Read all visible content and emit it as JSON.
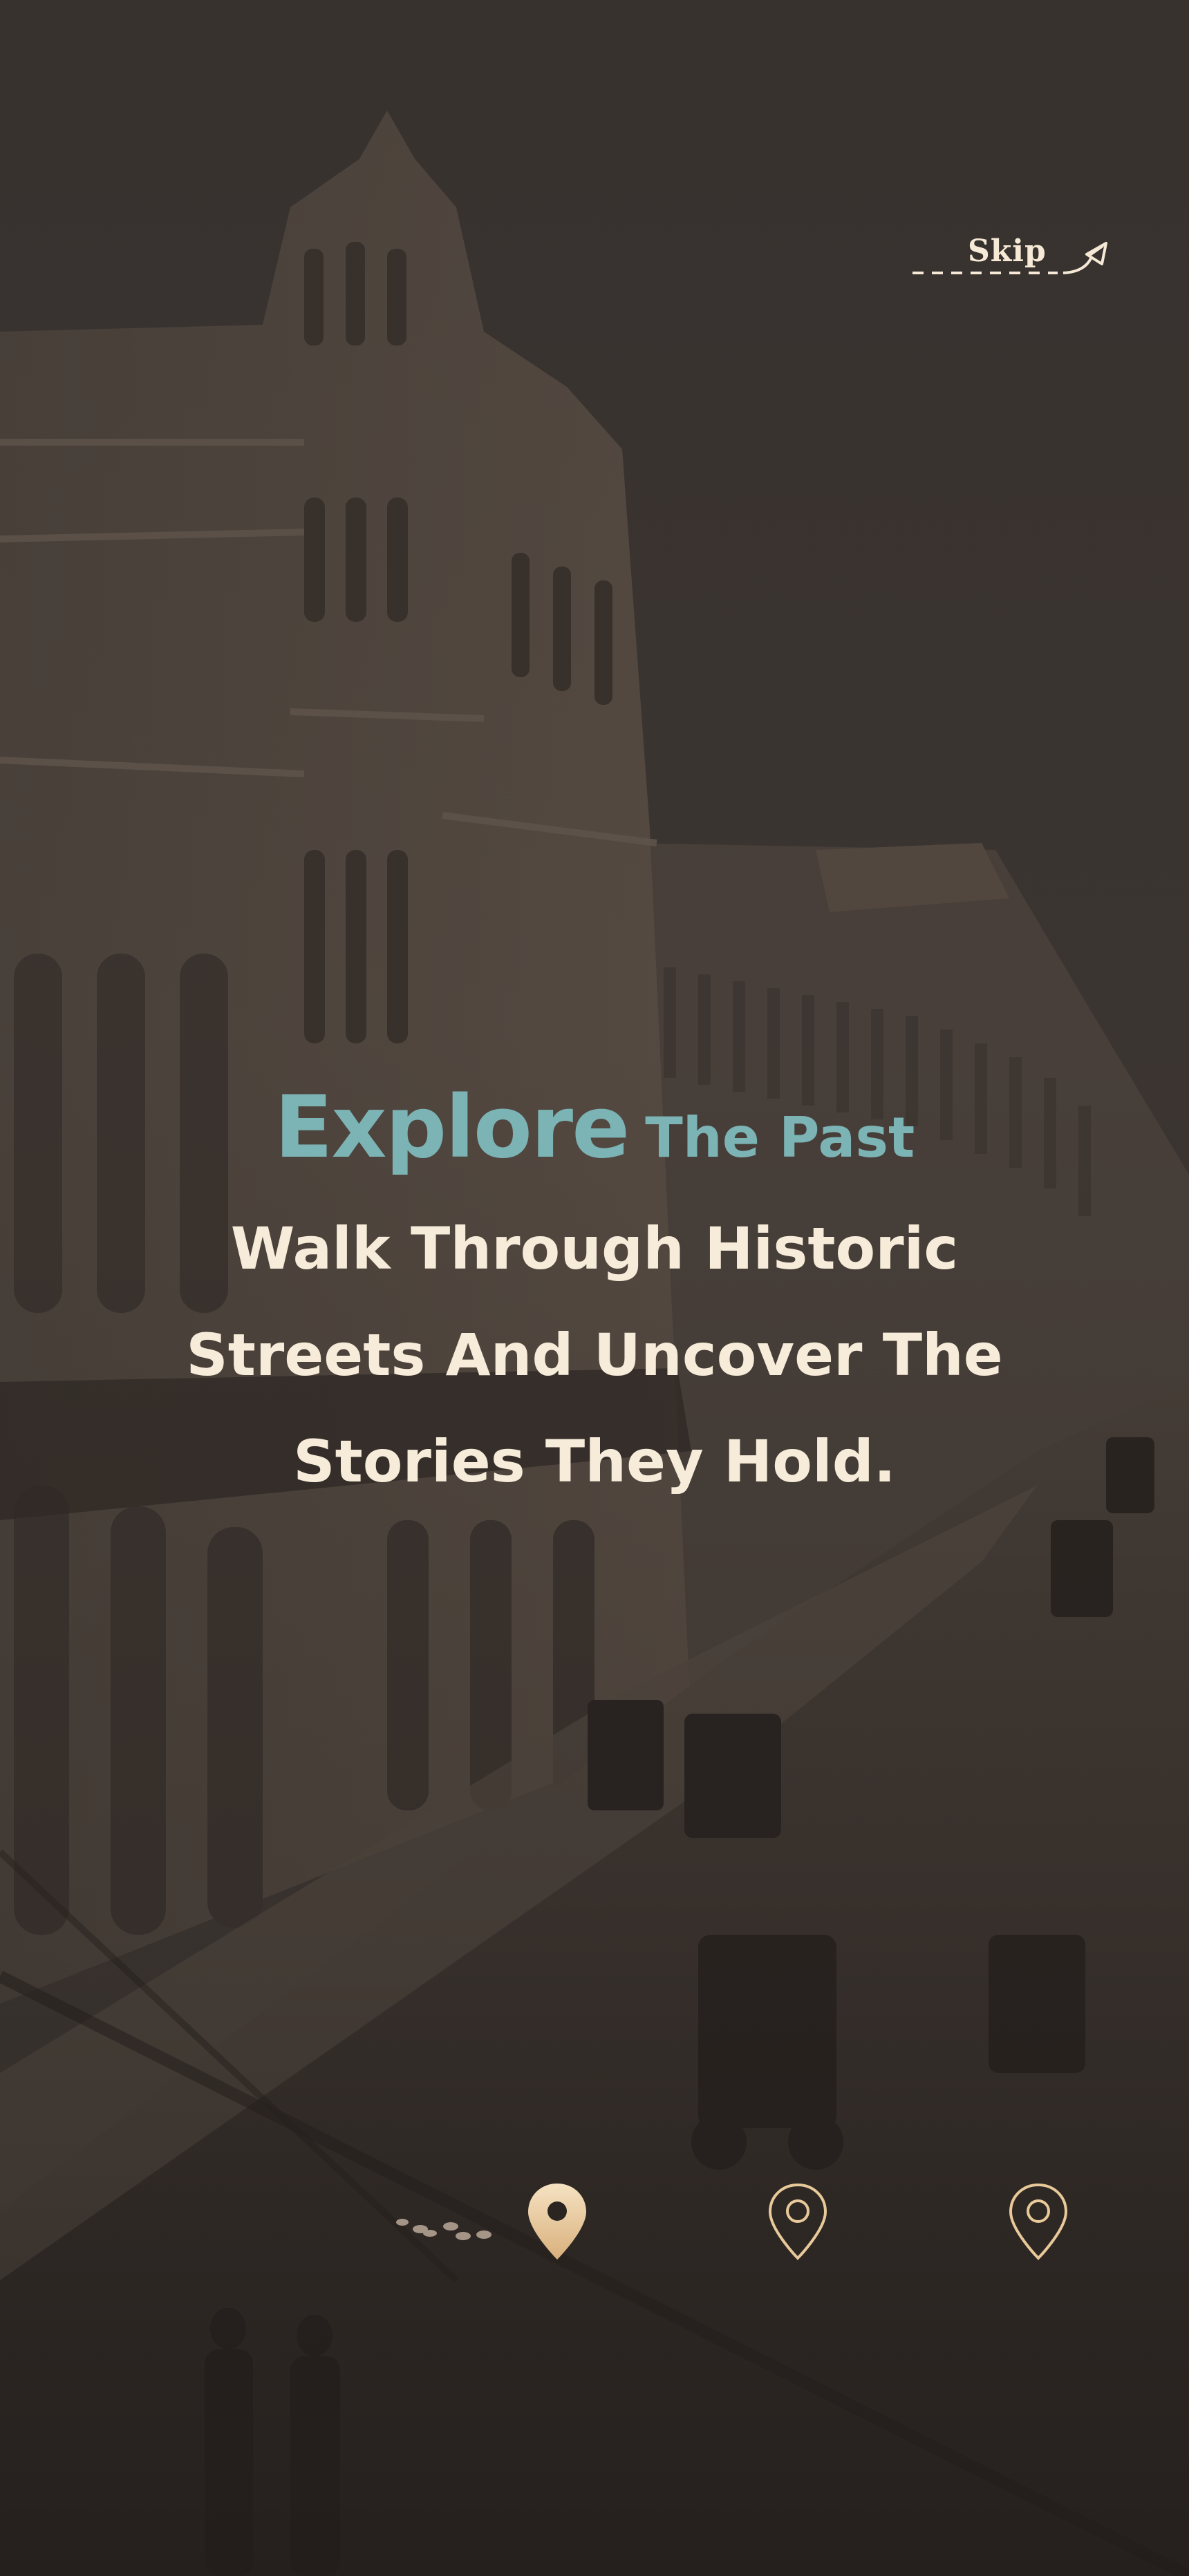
{
  "onboarding": {
    "skip_label": "Skip",
    "headline": {
      "emphasis": "Explore",
      "rest": "The Past"
    },
    "subtitle": "Walk Through Historic Streets And Uncover The Stories They Hold."
  },
  "pager": {
    "pages": 3,
    "current": 1,
    "steps": [
      {
        "icon": "location-pin-filled-icon",
        "state": "active"
      },
      {
        "icon": "location-pin-outline-icon",
        "state": "inactive"
      },
      {
        "icon": "location-pin-outline-icon",
        "state": "inactive"
      }
    ]
  },
  "colors": {
    "accent_teal": "#7cb3b5",
    "text_cream": "#f7ecd9",
    "pin_gold": "#e8c99a",
    "background_sepia": "#3a3431"
  },
  "background": {
    "description_icon": "historic-street-photo"
  }
}
